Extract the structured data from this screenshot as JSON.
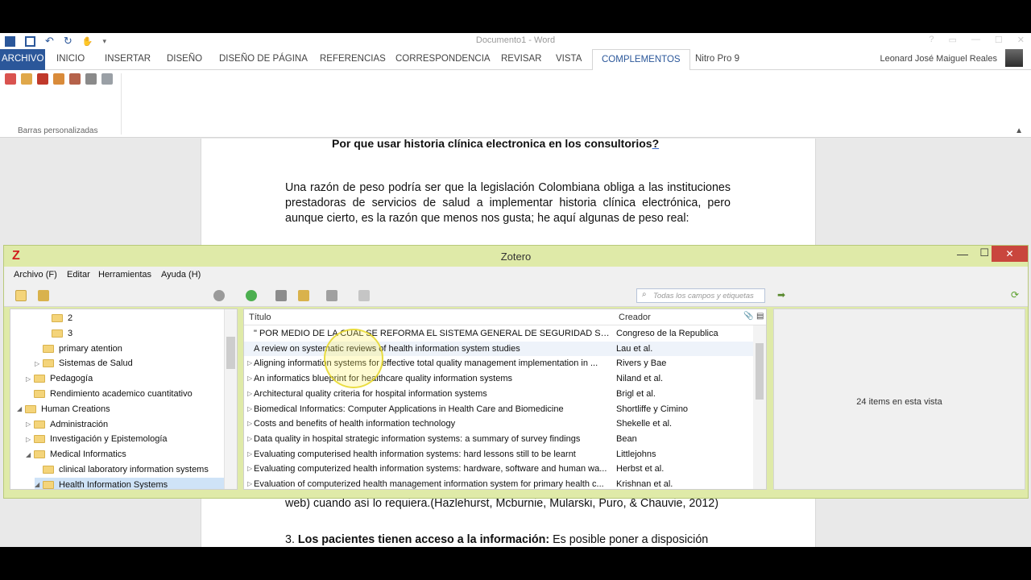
{
  "word": {
    "title": "Documento1 - Word",
    "tabs": [
      "ARCHIVO",
      "INICIO",
      "INSERTAR",
      "DISEÑO",
      "DISEÑO DE PÁGINA",
      "REFERENCIAS",
      "CORRESPONDENCIA",
      "REVISAR",
      "VISTA",
      "COMPLEMENTOS",
      "Nitro Pro 9"
    ],
    "active_tab": "COMPLEMENTOS",
    "user": "Leonard José Maiguel Reales",
    "ribbon_group_label": "Barras personalizadas",
    "window_controls": [
      "?",
      "restore",
      "minimize",
      "maximize",
      "close"
    ]
  },
  "document": {
    "heading": "Por que usar historia clínica electronica en los consultorios",
    "heading_q": "?",
    "paragraph": "Una razón de peso podría ser que la legislación Colombiana obliga a las instituciones prestadoras de servicios de salud a implementar historia clínica electrónica, pero aunque cierto, es la razón que menos nos gusta; he aquí algunas de peso real:",
    "bottom_line1_a": "web) cuando así lo requiera.",
    "bottom_line1_b": "(Hazlehurst, Mcburnie, Mularski, Puro, & Chauvie, 2012)",
    "bottom_line2_num": "3. ",
    "bottom_line2_bold": "Los pacientes tienen acceso a la información:",
    "bottom_line2_rest": " Es posible poner a disposición"
  },
  "zotero": {
    "title": "Zotero",
    "menu": [
      "Archivo (F)",
      "Editar",
      "Herramientas",
      "Ayuda (H)"
    ],
    "search_placeholder": "Todas los campos y etiquetas",
    "collections": [
      {
        "label": "2",
        "indent": 3,
        "twisty": ""
      },
      {
        "label": "3",
        "indent": 3,
        "twisty": ""
      },
      {
        "label": "primary atention",
        "indent": 2,
        "twisty": ""
      },
      {
        "label": "Sistemas de Salud",
        "indent": 2,
        "twisty": "▷"
      },
      {
        "label": "Pedagogía",
        "indent": 1,
        "twisty": "▷"
      },
      {
        "label": "Rendimiento academico cuantitativo",
        "indent": 1,
        "twisty": ""
      },
      {
        "label": "Human Creations",
        "indent": 0,
        "twisty": "◢"
      },
      {
        "label": "Administración",
        "indent": 1,
        "twisty": "▷"
      },
      {
        "label": "Investigación y Epistemología",
        "indent": 1,
        "twisty": "▷"
      },
      {
        "label": "Medical Informatics",
        "indent": 1,
        "twisty": "◢"
      },
      {
        "label": "clinical laboratory information systems",
        "indent": 2,
        "twisty": ""
      },
      {
        "label": "Health Information Systems",
        "indent": 2,
        "twisty": "◢"
      }
    ],
    "columns": {
      "title": "Título",
      "creator": "Creador"
    },
    "items": [
      {
        "title": "\" POR MEDIO DE LA CUAL SE REFORMA EL SISTEMA GENERAL DE SEGURIDAD SOCIAL E...",
        "creator": "Congreso de la Republica",
        "twisty": ""
      },
      {
        "title": "A review on systematic reviews of health information system studies",
        "creator": "Lau et al.",
        "twisty": ""
      },
      {
        "title": "Aligning information systems for effective total quality management implementation in ...",
        "creator": "Rivers y Bae",
        "twisty": "▷"
      },
      {
        "title": "An informatics blueprint for healthcare quality information systems",
        "creator": "Niland et al.",
        "twisty": "▷"
      },
      {
        "title": "Architectural quality criteria for hospital information systems",
        "creator": "Brigl et al.",
        "twisty": "▷"
      },
      {
        "title": "Biomedical Informatics: Computer Applications in Health Care and Biomedicine",
        "creator": "Shortliffe y Cimino",
        "twisty": "▷"
      },
      {
        "title": "Costs and benefits of health information technology",
        "creator": "Shekelle et al.",
        "twisty": "▷"
      },
      {
        "title": "Data quality in hospital strategic information systems: a summary of survey findings",
        "creator": "Bean",
        "twisty": "▷"
      },
      {
        "title": "Evaluating computerised health information systems: hard lessons still to be learnt",
        "creator": "Littlejohns",
        "twisty": "▷"
      },
      {
        "title": "Evaluating computerized health information systems: hardware, software and human wa...",
        "creator": "Herbst et al.",
        "twisty": "▷"
      },
      {
        "title": "Evaluation of computerized health management information system for primary health c...",
        "creator": "Krishnan et al.",
        "twisty": "▷"
      }
    ],
    "item_count": "24 items en esta vista"
  },
  "colors": {
    "word_blue": "#2b579a",
    "zotero_frame": "#dfeaa8",
    "close_red": "#c9463d"
  }
}
